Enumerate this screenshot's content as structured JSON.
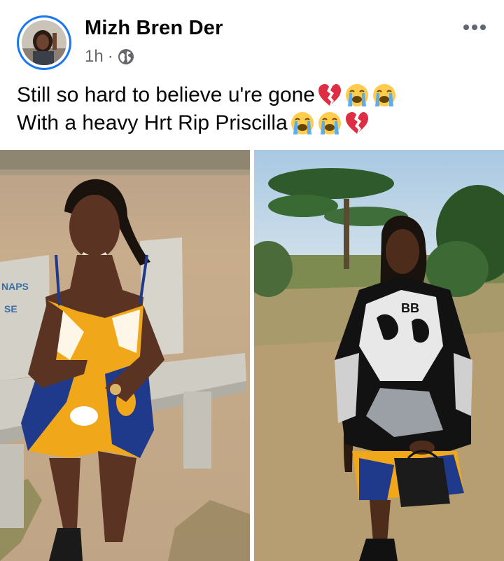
{
  "post": {
    "author": {
      "name": "Mizh Bren Der"
    },
    "timestamp": "1h",
    "separator": "·",
    "privacy_icon": "globe-icon",
    "more_icon": "more-options-icon",
    "text_lines": [
      {
        "text": "Still so hard to believe u're gone",
        "emojis": [
          "broken-heart-emoji",
          "loudly-crying-emoji",
          "loudly-crying-emoji"
        ]
      },
      {
        "text": "With a heavy Hrt Rip Priscilla",
        "emojis": [
          "loudly-crying-emoji",
          "loudly-crying-emoji",
          "broken-heart-emoji"
        ]
      }
    ],
    "photos": [
      {
        "bench_text_1": "NAPS",
        "bench_text_2": "SE"
      },
      {
        "hoodie_text": "BB"
      }
    ]
  },
  "colors": {
    "accent": "#1877f2",
    "text_primary": "#050505",
    "text_secondary": "#65676b"
  }
}
